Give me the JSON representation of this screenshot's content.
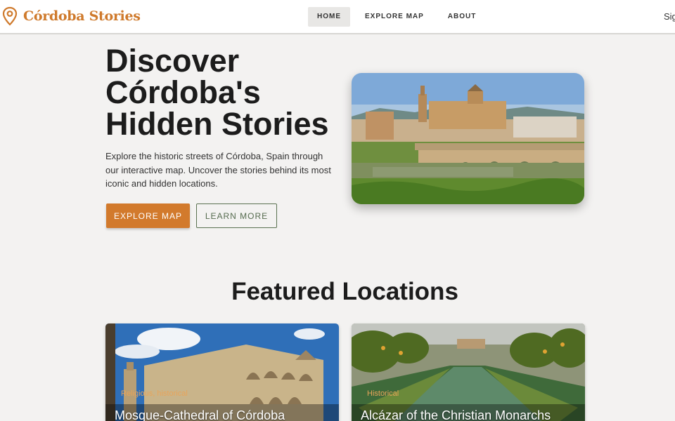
{
  "colors": {
    "accent": "#d27a2c",
    "brand": "#cf7a2c",
    "outline": "#5a7251",
    "background": "#f3f2f1"
  },
  "nav": {
    "brand": "Córdoba Stories",
    "brand_icon": "map-pin-icon",
    "links": [
      {
        "label": "HOME",
        "active": true
      },
      {
        "label": "EXPLORE MAP",
        "active": false
      },
      {
        "label": "ABOUT",
        "active": false
      }
    ],
    "signin": "Sig"
  },
  "hero": {
    "title": "Discover Córdoba's Hidden Stories",
    "subtitle": "Explore the historic streets of Córdoba, Spain through our interactive map. Uncover the stories behind its most iconic and hidden locations.",
    "primary_button": "EXPLORE MAP",
    "secondary_button": "LEARN MORE",
    "image": "mosque-cathedral-and-roman-bridge-photo"
  },
  "featured": {
    "title": "Featured Locations",
    "cards": [
      {
        "tag": "Religious, historical",
        "title": "Mosque-Cathedral of Córdoba",
        "image": "mosque-cathedral-photo"
      },
      {
        "tag": "Historical",
        "title": "Alcázar of the Christian Monarchs",
        "image": "alcazar-gardens-photo"
      }
    ]
  }
}
